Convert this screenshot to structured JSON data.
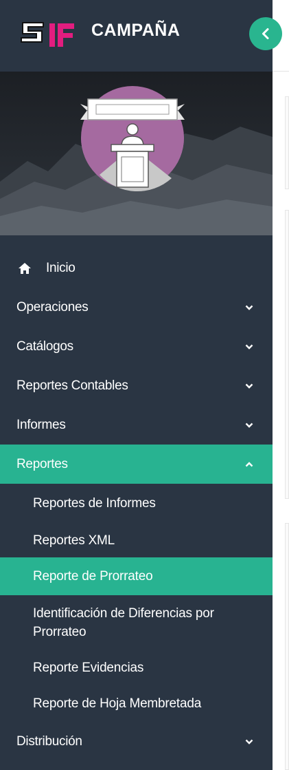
{
  "header": {
    "title": "CAMPAÑA",
    "logo_text": "SIF"
  },
  "colors": {
    "sidebar_bg": "#2a3543",
    "accent": "#28b391",
    "logo_pink": "#e21d7f",
    "banner_circle": "#a56aa0"
  },
  "menu": {
    "items": [
      {
        "label": "Inicio",
        "icon": "home-icon"
      },
      {
        "label": "Operaciones",
        "icon": "chevron-down-icon"
      },
      {
        "label": "Catálogos",
        "icon": "chevron-down-icon"
      },
      {
        "label": "Reportes Contables",
        "icon": "chevron-down-icon"
      },
      {
        "label": "Informes",
        "icon": "chevron-down-icon"
      },
      {
        "label": "Reportes",
        "icon": "chevron-up-icon",
        "expanded": true
      },
      {
        "label": "Distribución",
        "icon": "chevron-down-icon"
      }
    ],
    "submenu": [
      {
        "label": "Reportes de Informes"
      },
      {
        "label": "Reportes XML"
      },
      {
        "label": "Reporte de Prorrateo",
        "selected": true
      },
      {
        "label": "Identificación de Diferencias por Prorrateo"
      },
      {
        "label": "Reporte Evidencias"
      },
      {
        "label": "Reporte de Hoja Membretada"
      }
    ]
  }
}
